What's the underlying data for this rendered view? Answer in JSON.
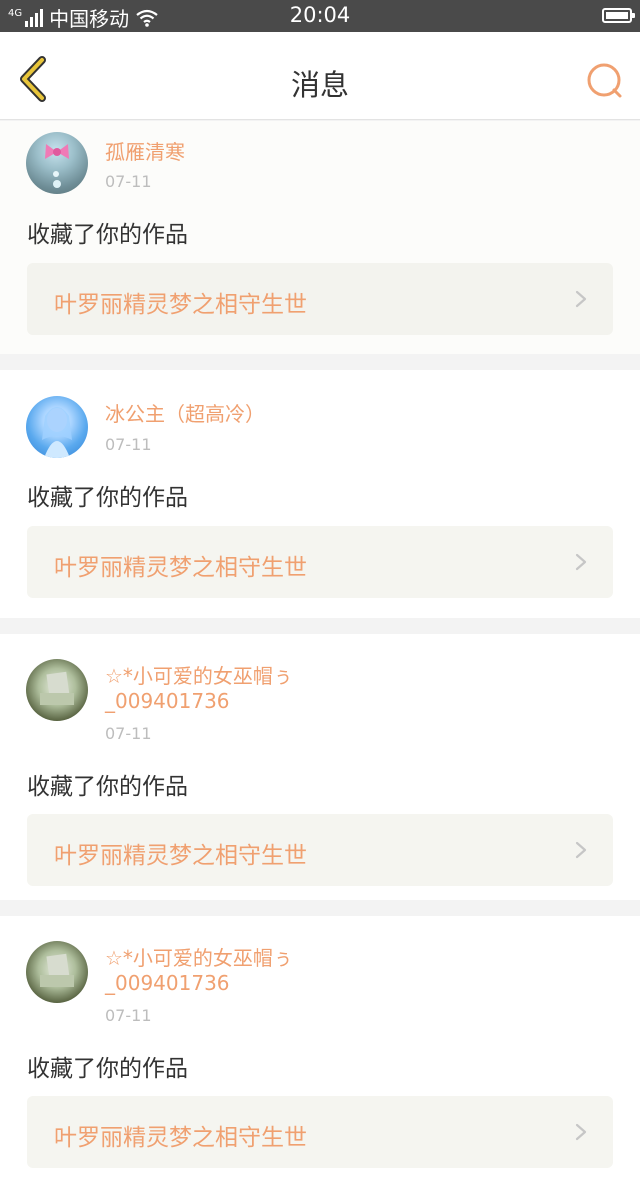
{
  "status_bar": {
    "network": "4G",
    "carrier": "中国移动",
    "time": "20:04",
    "icons": [
      "signal-icon",
      "wifi-icon",
      "battery-icon"
    ]
  },
  "header": {
    "title": "消息",
    "back_icon": "chevron-left-icon",
    "search_icon": "search-icon",
    "accent_color": "#f0a070",
    "back_color": "#e8c53a"
  },
  "messages": [
    {
      "username": "孤雁清寒",
      "date": "07-11",
      "action": "收藏了你的作品",
      "work_title": "叶罗丽精灵梦之相守生世"
    },
    {
      "username": "冰公主（超高冷）",
      "date": "07-11",
      "action": "收藏了你的作品",
      "work_title": "叶罗丽精灵梦之相守生世"
    },
    {
      "username": "☆*小可爱的女巫帽ぅ",
      "username_line2": "_009401736",
      "date": "07-11",
      "action": "收藏了你的作品",
      "work_title": "叶罗丽精灵梦之相守生世"
    },
    {
      "username": "☆*小可爱的女巫帽ぅ",
      "username_line2": "_009401736",
      "date": "07-11",
      "action": "收藏了你的作品",
      "work_title": "叶罗丽精灵梦之相守生世"
    }
  ]
}
